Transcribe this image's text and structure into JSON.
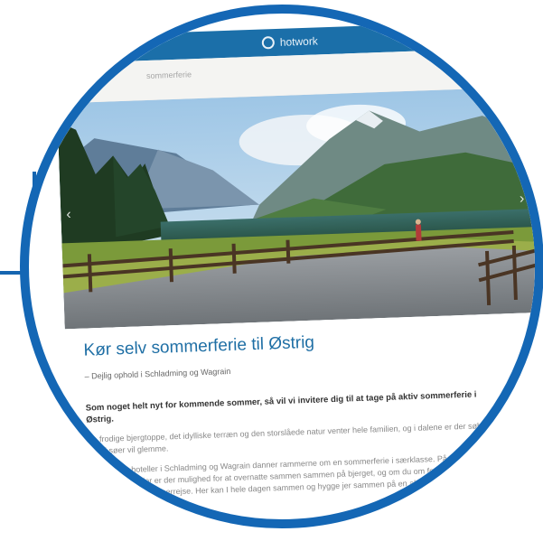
{
  "header": {
    "brand": "hotwork",
    "logo_icon": "circle-logo-icon"
  },
  "search": {
    "placeholder": "sommerferie"
  },
  "hero": {
    "prev_icon": "chevron-left-icon",
    "next_icon": "chevron-right-icon"
  },
  "article": {
    "title": "Kør selv sommerferie til Østrig",
    "subtitle": "– Dejlig ophold i Schladming og Wagrain",
    "lead": "Som noget helt nyt for kommende sommer, så vil vi invitere dig til at tage på aktiv sommerferie i Østrig.",
    "paragraph_1": "De frodige bjergtoppe, det idylliske terræn og den storslåede natur venter hele familien, og i dalene er der søbadet, som i søer vil glemme.",
    "paragraph_2": "Vores egne hoteller i Schladming og Wagrain danner rammerne om en sommerferie i særklasse. På vores kroer, hyggelige hoteller er der mulighed for at overnatte sammen sammen på bjerget, og om du om formiddagen, ved selv med egen sommerrejse. Her kan I hele dagen sammen og hygge jer sammen på en aktiv ferie for hele familien."
  }
}
